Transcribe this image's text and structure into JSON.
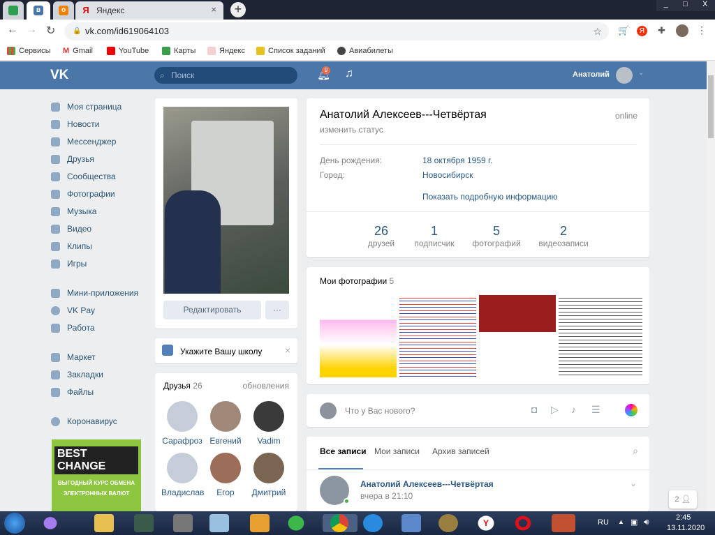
{
  "browser": {
    "tabs": [
      {
        "label": ""
      },
      {
        "label": ""
      },
      {
        "label": ""
      },
      {
        "label": "Яндекс"
      }
    ],
    "window_controls": [
      "_",
      "□",
      "X"
    ],
    "url": "vk.com/id619064103",
    "bookmarks": [
      "Сервисы",
      "Gmail",
      "YouTube",
      "Карты",
      "Яндекс",
      "Список заданий",
      "Авиабилеты"
    ]
  },
  "header": {
    "search_placeholder": "Поиск",
    "notifications_count": "9",
    "user_name": "Анатолий",
    "logo": "VK"
  },
  "sidebar": {
    "items": [
      "Моя страница",
      "Новости",
      "Мессенджер",
      "Друзья",
      "Сообщества",
      "Фотографии",
      "Музыка",
      "Видео",
      "Клипы",
      "Игры"
    ],
    "items2": [
      "Мини-приложения",
      "VK Pay",
      "Работа"
    ],
    "items3": [
      "Маркет",
      "Закладки",
      "Файлы"
    ],
    "items4": [
      "Коронавирус"
    ],
    "ad": {
      "title": "BEST CHANGE",
      "line1": "ВЫГОДНЫЙ КУРС ОБМЕНА",
      "line2": "ЭЛЕКТРОННЫХ ВАЛЮТ"
    }
  },
  "profile": {
    "edit_label": "Редактировать",
    "more_label": "···",
    "school_prompt": "Укажите Вашу школу",
    "name": "Анатолий Алексеев---Четвёртая",
    "online": "online",
    "status": "изменить статус",
    "birthday_label": "День рождения:",
    "birthday": "18 октября 1959 г.",
    "city_label": "Город:",
    "city": "Новосибирск",
    "more_info": "Показать подробную информацию",
    "stats": [
      {
        "n": "26",
        "l": "друзей"
      },
      {
        "n": "1",
        "l": "подписчик"
      },
      {
        "n": "5",
        "l": "фотографий"
      },
      {
        "n": "2",
        "l": "видеозаписи"
      }
    ]
  },
  "friends": {
    "title": "Друзья",
    "count": "26",
    "updates": "обновления",
    "list": [
      "Сарафроз",
      "Евгений",
      "Vadim",
      "Владислав",
      "Егор",
      "Дмитрий"
    ]
  },
  "photos": {
    "title": "Мои фотографии",
    "count": "5"
  },
  "composer": {
    "placeholder": "Что у Вас нового?"
  },
  "wall": {
    "tabs": [
      "Все записи",
      "Мои записи",
      "Архив записей"
    ],
    "post_author": "Анатолий Алексеев---Четвёртая",
    "post_time": "вчера в 21:10"
  },
  "chat_badge": "2",
  "taskbar": {
    "lang": "RU",
    "time": "2:45",
    "date": "13.11.2020"
  }
}
